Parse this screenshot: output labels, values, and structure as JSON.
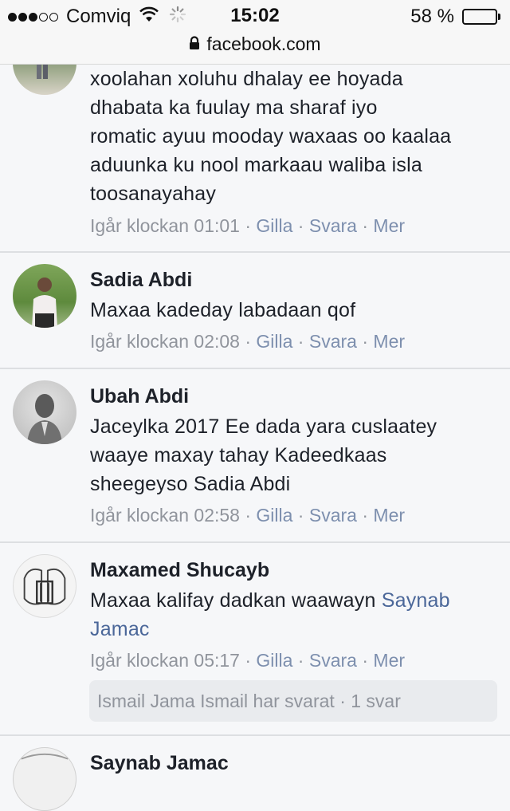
{
  "status_bar": {
    "carrier": "Comviq",
    "time": "15:02",
    "battery_percent": "58 %",
    "battery_level": 0.58,
    "url": "facebook.com"
  },
  "comments": [
    {
      "lines": [
        "xoolahan xoluhu dhalay ee hoyada",
        "dhabata ka fuulay ma sharaf iyo",
        "romatic ayuu mooday waxaas oo kaalaa",
        "aduunka ku nool markaau waliba isla",
        "toosanayahay"
      ],
      "time": "Igår klockan 01:01",
      "like": "Gilla",
      "reply": "Svara",
      "more": "Mer"
    },
    {
      "author": "Sadia Abdi",
      "lines": [
        "Maxaa kadeday labadaan qof"
      ],
      "time": "Igår klockan 02:08",
      "like": "Gilla",
      "reply": "Svara",
      "more": "Mer"
    },
    {
      "author": "Ubah Abdi",
      "lines": [
        "Jaceylka 2017 Ee dada yara cuslaatey",
        "waaye maxay tahay Kadeedkaas",
        "sheegeyso Sadia Abdi"
      ],
      "time": "Igår klockan 02:58",
      "like": "Gilla",
      "reply": "Svara",
      "more": "Mer"
    },
    {
      "author": "Maxamed Shucayb",
      "text_before": "Maxaa kalifay dadkan waawayn ",
      "mention_part1": "Saynab",
      "mention_part2": "Jamac",
      "time": "Igår klockan 05:17",
      "like": "Gilla",
      "reply": "Svara",
      "more": "Mer",
      "replies_summary": "Ismail Jama Ismail har svarat · 1 svar"
    },
    {
      "author": "Saynab Jamac"
    }
  ],
  "separator": " · "
}
